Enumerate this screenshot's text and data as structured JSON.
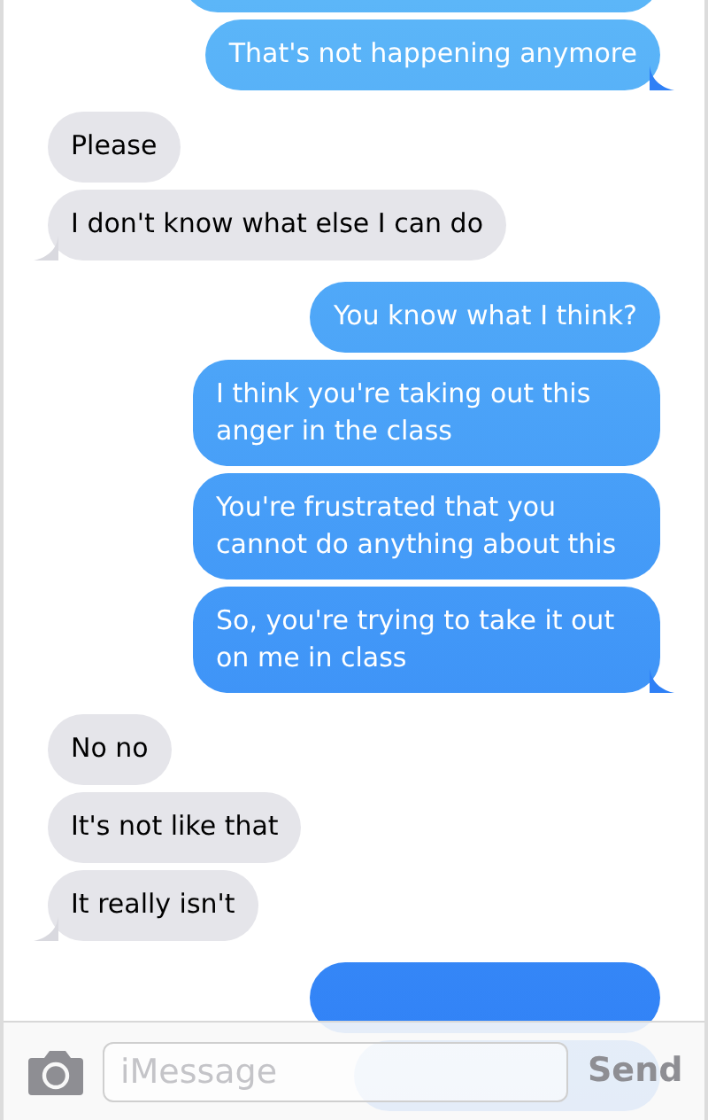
{
  "messages": [
    {
      "kind": "sent"
    },
    {
      "kind": "sent",
      "text": "That's not happening anymore",
      "tail": true
    },
    {
      "kind": "received",
      "text": "Please",
      "tail": false
    },
    {
      "kind": "received",
      "text": "I don't know what else I can do",
      "tail": true
    },
    {
      "kind": "sent",
      "text": "You know what I think?",
      "tail": false
    },
    {
      "kind": "sent",
      "text": "I think you're taking out this anger in the class",
      "tail": false
    },
    {
      "kind": "sent",
      "text": "You're frustrated that you cannot do anything about this",
      "tail": false
    },
    {
      "kind": "sent",
      "text": "So, you're trying to take it out on me in class",
      "tail": true
    },
    {
      "kind": "received",
      "text": "No no",
      "tail": false
    },
    {
      "kind": "received",
      "text": "It's not like that",
      "tail": false
    },
    {
      "kind": "received",
      "text": "It really isn't",
      "tail": true
    },
    {
      "kind": "sent_covered"
    },
    {
      "kind": "sent_covered"
    }
  ],
  "composer": {
    "placeholder": "iMessage",
    "send": "Send"
  }
}
